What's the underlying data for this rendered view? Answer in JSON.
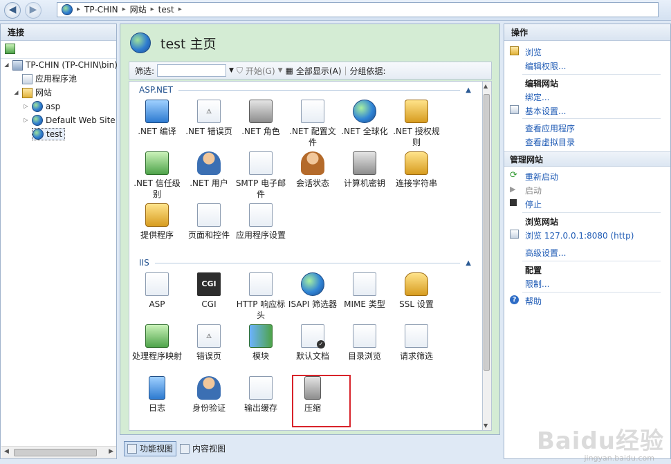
{
  "address": {
    "crumbs": [
      "TP-CHIN",
      "网站",
      "test"
    ]
  },
  "left_pane": {
    "title": "连接",
    "tree": [
      {
        "label": "TP-CHIN (TP-CHIN\\bin)",
        "icon": "server-icon"
      },
      {
        "label": "应用程序池",
        "icon": "app-pool-icon"
      },
      {
        "label": "网站",
        "icon": "sites-folder-icon"
      },
      {
        "label": "asp",
        "icon": "globe-icon"
      },
      {
        "label": "Default Web Site",
        "icon": "globe-icon"
      },
      {
        "label": "test",
        "icon": "globe-icon"
      }
    ]
  },
  "center": {
    "title": "test 主页",
    "filter": {
      "label": "筛选:",
      "start": "开始(G)",
      "show_all": "全部显示(A)",
      "group_by": "分组依据:"
    },
    "groups": [
      {
        "name": "ASP.NET",
        "features": [
          {
            "label": ".NET 编译"
          },
          {
            "label": ".NET 错误页"
          },
          {
            "label": ".NET 角色"
          },
          {
            "label": ".NET 配置文件"
          },
          {
            "label": ".NET 全球化"
          },
          {
            "label": ".NET 授权规则"
          },
          {
            "label": ".NET 信任级别"
          },
          {
            "label": ".NET 用户"
          },
          {
            "label": "SMTP 电子邮件"
          },
          {
            "label": "会话状态"
          },
          {
            "label": "计算机密钥"
          },
          {
            "label": "连接字符串"
          },
          {
            "label": "提供程序"
          },
          {
            "label": "页面和控件"
          },
          {
            "label": "应用程序设置"
          }
        ]
      },
      {
        "name": "IIS",
        "features": [
          {
            "label": "ASP"
          },
          {
            "label": "CGI"
          },
          {
            "label": "HTTP 响应标头"
          },
          {
            "label": "ISAPI 筛选器"
          },
          {
            "label": "MIME 类型"
          },
          {
            "label": "SSL 设置"
          },
          {
            "label": "处理程序映射"
          },
          {
            "label": "错误页"
          },
          {
            "label": "模块"
          },
          {
            "label": "默认文档"
          },
          {
            "label": "目录浏览"
          },
          {
            "label": "请求筛选"
          },
          {
            "label": "日志"
          },
          {
            "label": "身份验证"
          },
          {
            "label": "输出缓存"
          },
          {
            "label": "压缩"
          }
        ]
      }
    ],
    "cgi_text": "CGI"
  },
  "bottom_tabs": {
    "features_view": "功能视图",
    "content_view": "内容视图"
  },
  "right_pane": {
    "title": "操作",
    "browse": "浏览",
    "edit_permissions": "编辑权限...",
    "edit_site_header": "编辑网站",
    "bindings": "绑定...",
    "basic_settings": "基本设置...",
    "view_apps": "查看应用程序",
    "view_vdirs": "查看虚拟目录",
    "manage_site_header": "管理网站",
    "restart": "重新启动",
    "start": "启动",
    "stop": "停止",
    "browse_site_header": "浏览网站",
    "browse_url": "浏览 127.0.0.1:8080 (http)",
    "advanced_settings": "高级设置...",
    "config_header": "配置",
    "limits": "限制...",
    "help": "帮助"
  },
  "watermark": {
    "brand": "Baidu经验",
    "url": "jingyan.baidu.com"
  }
}
